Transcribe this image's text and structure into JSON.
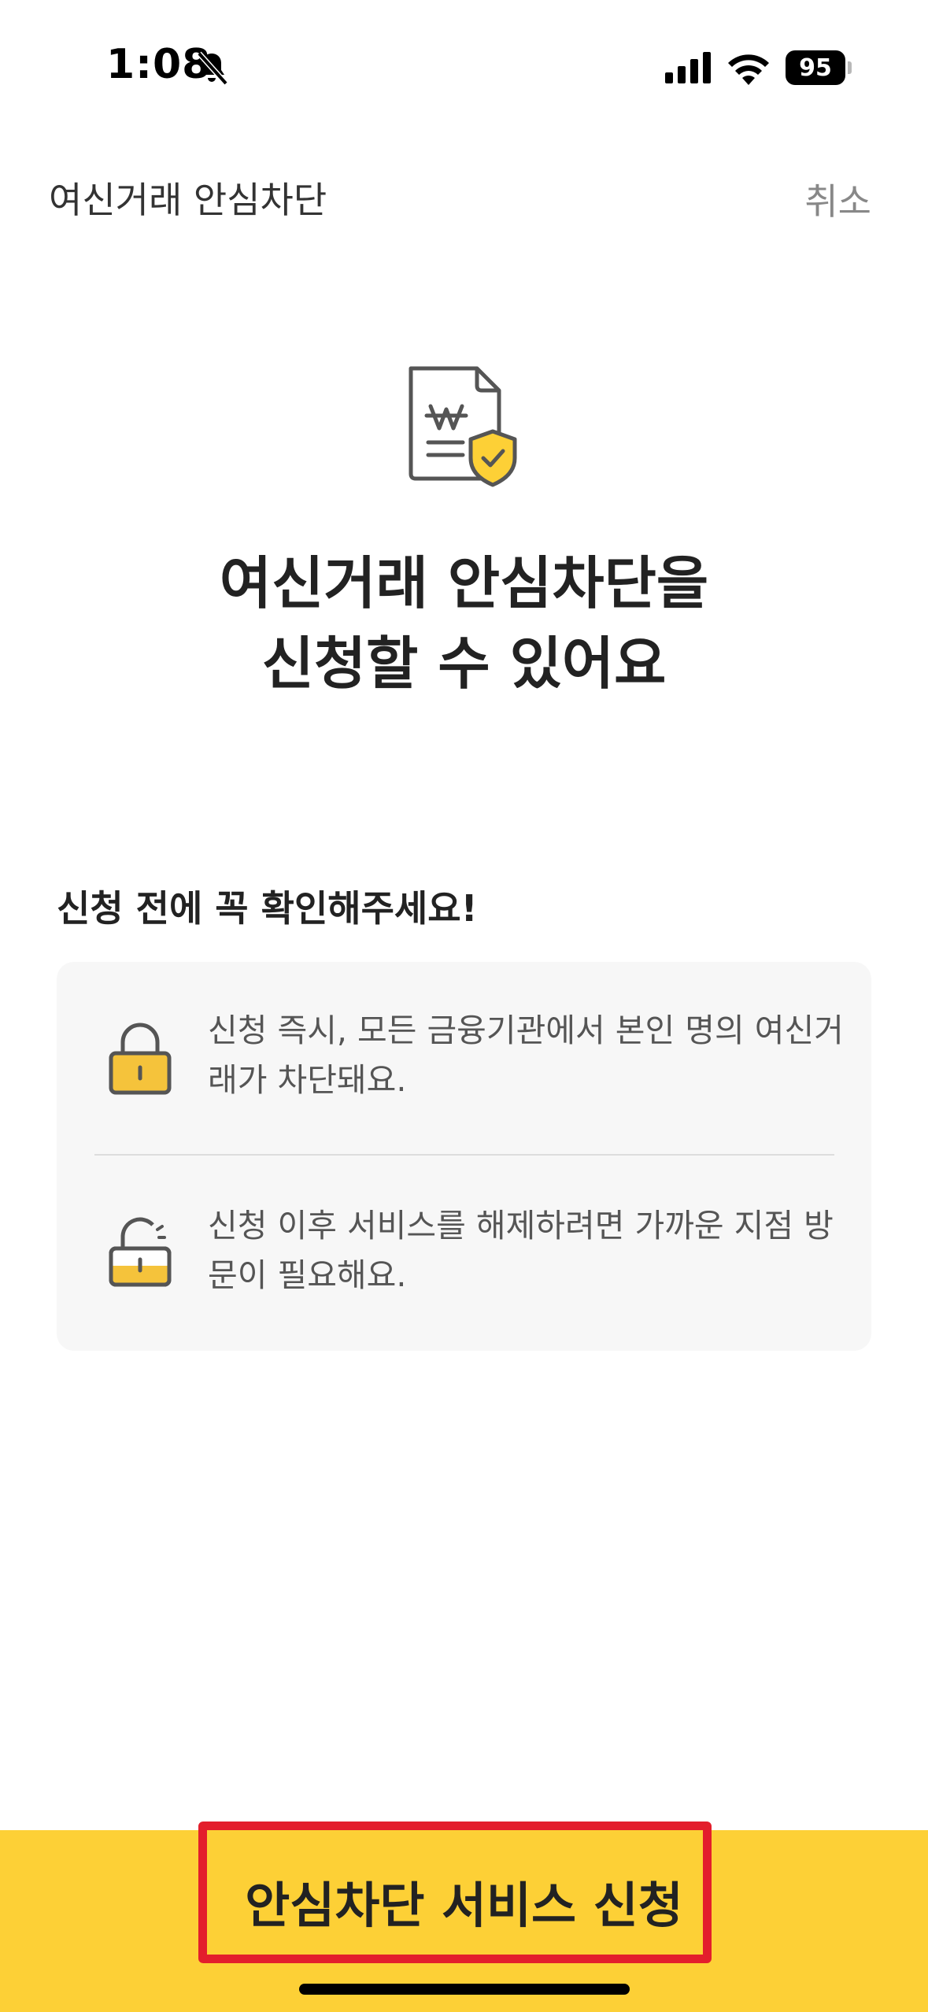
{
  "status_bar": {
    "time": "1:08",
    "battery_level": "95",
    "icons": [
      "bell-slash-icon",
      "cellular-signal-icon",
      "wifi-icon",
      "battery-icon"
    ]
  },
  "header": {
    "title": "여신거래 안심차단",
    "cancel_label": "취소"
  },
  "hero": {
    "icon": "document-won-shield-icon",
    "title_line1": "여신거래 안심차단을",
    "title_line2": "신청할 수 있어요"
  },
  "notice": {
    "heading": "신청 전에 꼭 확인해주세요!",
    "items": [
      {
        "icon": "locked-padlock-icon",
        "text": "신청 즉시, 모든 금융기관에서 본인 명의 여신거래가 차단돼요."
      },
      {
        "icon": "unlocked-padlock-icon",
        "text": "신청 이후 서비스를 해제하려면 가까운 지점 방문이 필요해요."
      }
    ]
  },
  "cta": {
    "label": "안심차단 서비스 신청"
  },
  "colors": {
    "accent_yellow": "#fdd036",
    "highlight_red": "#e31e2c",
    "card_background": "#f7f7f7",
    "secondary_text": "#888888"
  }
}
